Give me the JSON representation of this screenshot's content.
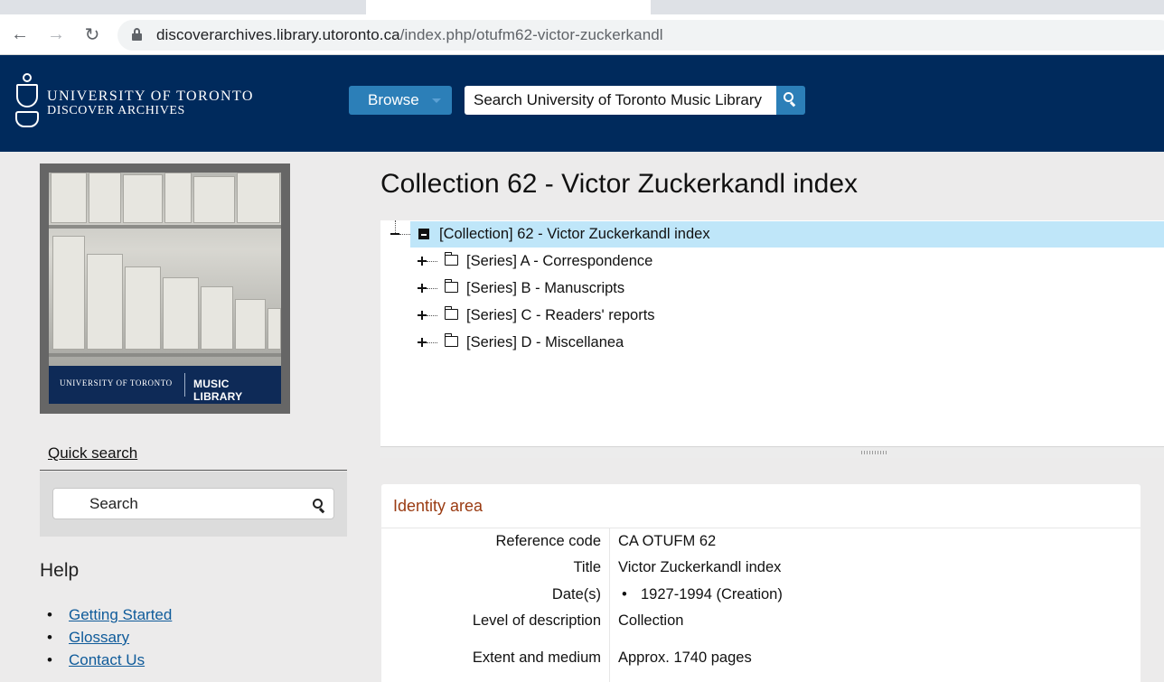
{
  "browser": {
    "url_host": "discoverarchives.library.utoronto.ca",
    "url_path": "/index.php/otufm62-victor-zuckerkandl"
  },
  "header": {
    "brand_line1": "UNIVERSITY OF TORONTO",
    "brand_line2": "DISCOVER ARCHIVES",
    "browse_label": "Browse",
    "search_placeholder": "Search University of Toronto Music Library",
    "bg_color": "#002a5c",
    "accent_color": "#2c7fb8"
  },
  "sidebar": {
    "logo_band_left": "UNIVERSITY OF TORONTO",
    "logo_band_right": "MUSIC LIBRARY",
    "quick_search_tab": "Quick search",
    "quick_search_placeholder": "Search",
    "help_title": "Help",
    "help_links": [
      "Getting Started",
      "Glossary",
      "Contact Us"
    ]
  },
  "main": {
    "title": "Collection 62 - Victor Zuckerkandl index",
    "tree": {
      "root": "[Collection] 62 - Victor Zuckerkandl index",
      "children": [
        "[Series] A - Correspondence",
        "[Series] B - Manuscripts",
        "[Series] C - Readers' reports",
        "[Series] D - Miscellanea"
      ],
      "selected_color": "#bfe6f9"
    },
    "identity": {
      "title": "Identity area",
      "fields": [
        {
          "label": "Reference code",
          "value": "CA OTUFM 62"
        },
        {
          "label": "Title",
          "value": "Victor Zuckerkandl index"
        },
        {
          "label": "Date(s)",
          "value": "1927-1994 (Creation)"
        },
        {
          "label": "Level of description",
          "value": "Collection"
        },
        {
          "label": "Extent and medium",
          "value": "Approx. 1740 pages"
        }
      ],
      "title_color": "#9a3b12"
    }
  }
}
